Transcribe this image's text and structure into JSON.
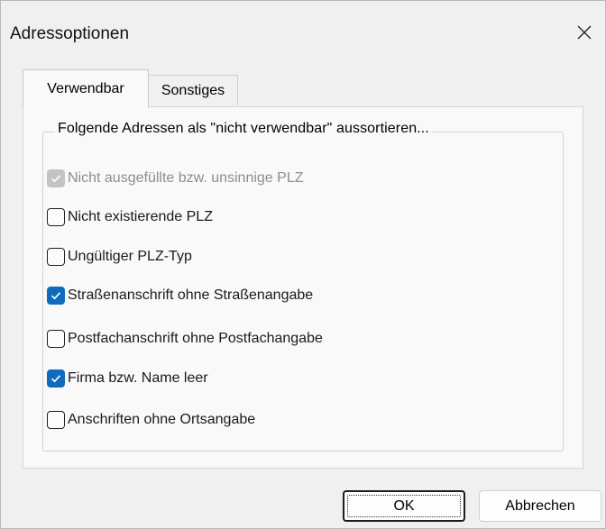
{
  "window": {
    "title": "Adressoptionen"
  },
  "tabs": [
    {
      "label": "Verwendbar",
      "active": true
    },
    {
      "label": "Sonstiges",
      "active": false
    }
  ],
  "group": {
    "title": "Folgende Adressen als \"nicht verwendbar\" aussortieren..."
  },
  "options": [
    {
      "label": "Nicht ausgefüllte bzw. unsinnige PLZ",
      "checked": true,
      "disabled": true
    },
    {
      "label": "Nicht existierende PLZ",
      "checked": false,
      "disabled": false
    },
    {
      "label": "Ungültiger PLZ-Typ",
      "checked": false,
      "disabled": false
    },
    {
      "label": "Straßenanschrift ohne Straßenangabe",
      "checked": true,
      "disabled": false
    },
    {
      "label": "Postfachanschrift ohne Postfachangabe",
      "checked": false,
      "disabled": false
    },
    {
      "label": "Firma bzw. Name leer",
      "checked": true,
      "disabled": false
    },
    {
      "label": "Anschriften ohne Ortsangabe",
      "checked": false,
      "disabled": false
    }
  ],
  "buttons": {
    "ok": "OK",
    "cancel": "Abbrechen"
  },
  "colors": {
    "accent": "#0f6cbd",
    "disabled": "#c3c3c3"
  },
  "icons": {
    "close": "close-icon",
    "check": "checkmark-icon"
  }
}
